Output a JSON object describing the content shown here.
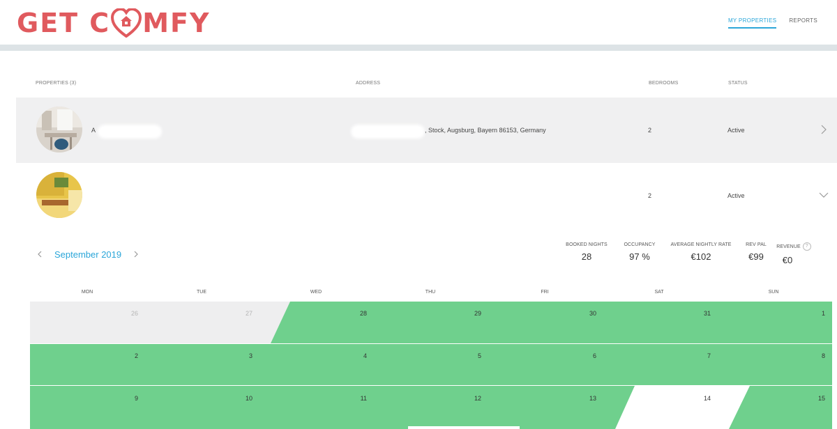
{
  "app": {
    "logo": {
      "part1": "GET C",
      "part2": "MFY",
      "heart_icon": "house-heart-icon",
      "color": "#e05a5e"
    },
    "nav": [
      {
        "label": "MY PROPERTIES",
        "active": true
      },
      {
        "label": "REPORTS",
        "active": false
      }
    ],
    "accent": "#2ba6d9"
  },
  "table": {
    "headers": {
      "properties": "PROPERTIES (3)",
      "address": "ADDRESS",
      "bedrooms": "BEDROOMS",
      "status": "STATUS"
    },
    "rows": [
      {
        "name": "A",
        "address": ", Stock, Augsburg, Bayern 86153, Germany",
        "bedrooms": "2",
        "status": "Active",
        "expand_icon": "chevron-right-icon"
      },
      {
        "name": "",
        "address": "",
        "bedrooms": "2",
        "status": "Active",
        "expand_icon": "chevron-down-icon"
      }
    ]
  },
  "calendar": {
    "month": "September 2019",
    "prev_icon": "chevron-left-icon",
    "next_icon": "chevron-right-icon",
    "stats": [
      {
        "label": "BOOKED NIGHTS",
        "value": "28"
      },
      {
        "label": "OCCUPANCY",
        "value": "97 %"
      },
      {
        "label": "AVERAGE NIGHTLY RATE",
        "value": "€102"
      },
      {
        "label": "REV PAL",
        "value": "€99"
      },
      {
        "label": "REVENUE",
        "value": "€0"
      }
    ],
    "weekdays": [
      "MON",
      "TUE",
      "WED",
      "THU",
      "FRI",
      "SAT",
      "SUN"
    ],
    "weeks": [
      [
        "26",
        "27",
        "28",
        "29",
        "30",
        "31",
        "1"
      ],
      [
        "2",
        "3",
        "4",
        "5",
        "6",
        "7",
        "8"
      ],
      [
        "9",
        "10",
        "11",
        "12",
        "13",
        "14",
        "15"
      ]
    ],
    "booked_color": "#6fd08d",
    "empty_color": "#eeeeef"
  }
}
